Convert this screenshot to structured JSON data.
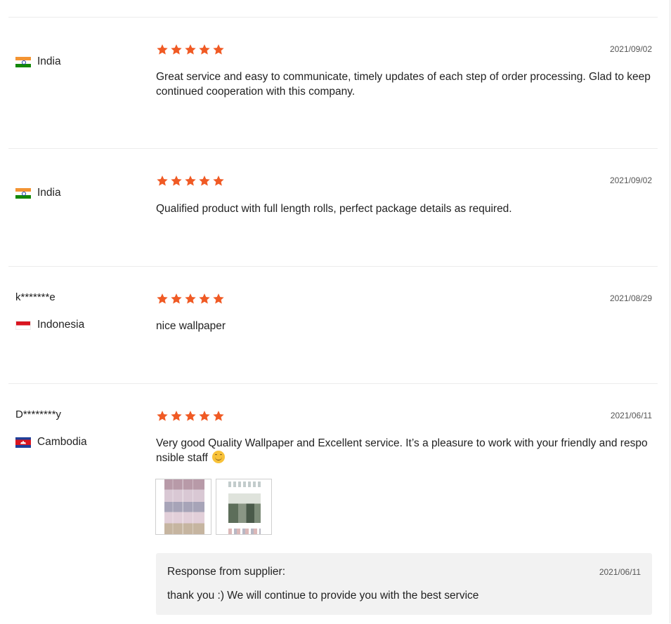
{
  "colors": {
    "star": "#f05a24",
    "divider": "#ececec",
    "response_bg": "#f2f2f2"
  },
  "reviews": [
    {
      "buyer": "",
      "country": "India",
      "flag": "india-flag",
      "rating": 5,
      "date": "2021/09/02",
      "comment": "Great service and easy to communicate, timely updates of each step of order processing. Glad to keep continued cooperation with this company."
    },
    {
      "buyer": "",
      "country": "India",
      "flag": "india-flag",
      "rating": 5,
      "date": "2021/09/02",
      "comment": "Qualified product with full length rolls, perfect package details as required."
    },
    {
      "buyer": "k*******e",
      "country": "Indonesia",
      "flag": "indonesia-flag",
      "rating": 5,
      "date": "2021/08/29",
      "comment": "nice wallpaper"
    },
    {
      "buyer": "D********y",
      "country": "Cambodia",
      "flag": "cambodia-flag",
      "rating": 5,
      "date": "2021/06/11",
      "comment": "Very good Quality Wallpaper and Excellent service. It’s a pleasure to work with your friendly and responsible staff",
      "emoji": "smiling-face-emoji",
      "photos": [
        "wallpaper-rolls-photo",
        "packed-boxes-photo"
      ],
      "response": {
        "title": "Response from supplier:",
        "date": "2021/06/11",
        "text": "thank you :) We will continue to provide you with the best service"
      }
    }
  ]
}
